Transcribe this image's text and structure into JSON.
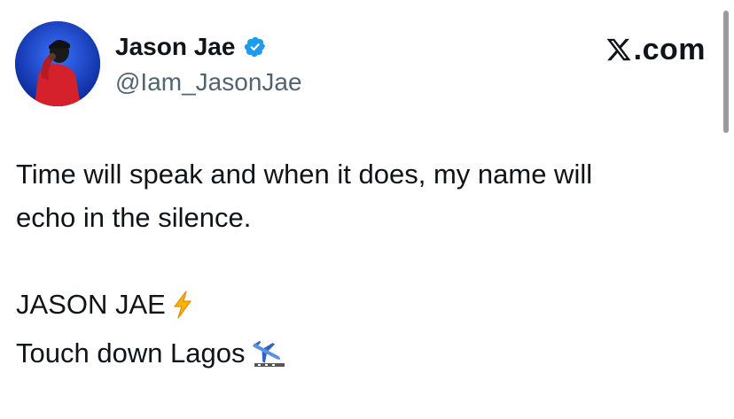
{
  "author": {
    "display_name": "Jason Jae",
    "handle": "@Iam_JasonJae",
    "verified_icon": "verified-badge",
    "avatar_icon": "profile-photo"
  },
  "brand": {
    "logo_icon": "x-logo",
    "suffix": ".com"
  },
  "tweet": {
    "line1": "Time will speak and when it does, my name will",
    "line2": "echo in the silence.",
    "line3": "JASON JAE",
    "line3_emoji_icon": "lightning-bolt-emoji",
    "line4": "Touch down Lagos",
    "line4_emoji_icon": "airplane-arrival-emoji"
  },
  "colors": {
    "text": "#0f1419",
    "handle": "#536471",
    "verified": "#1d9bf0",
    "avatar_bg": "#1d4fd8",
    "jacket": "#d4212b",
    "lightning": "#f5b400"
  }
}
